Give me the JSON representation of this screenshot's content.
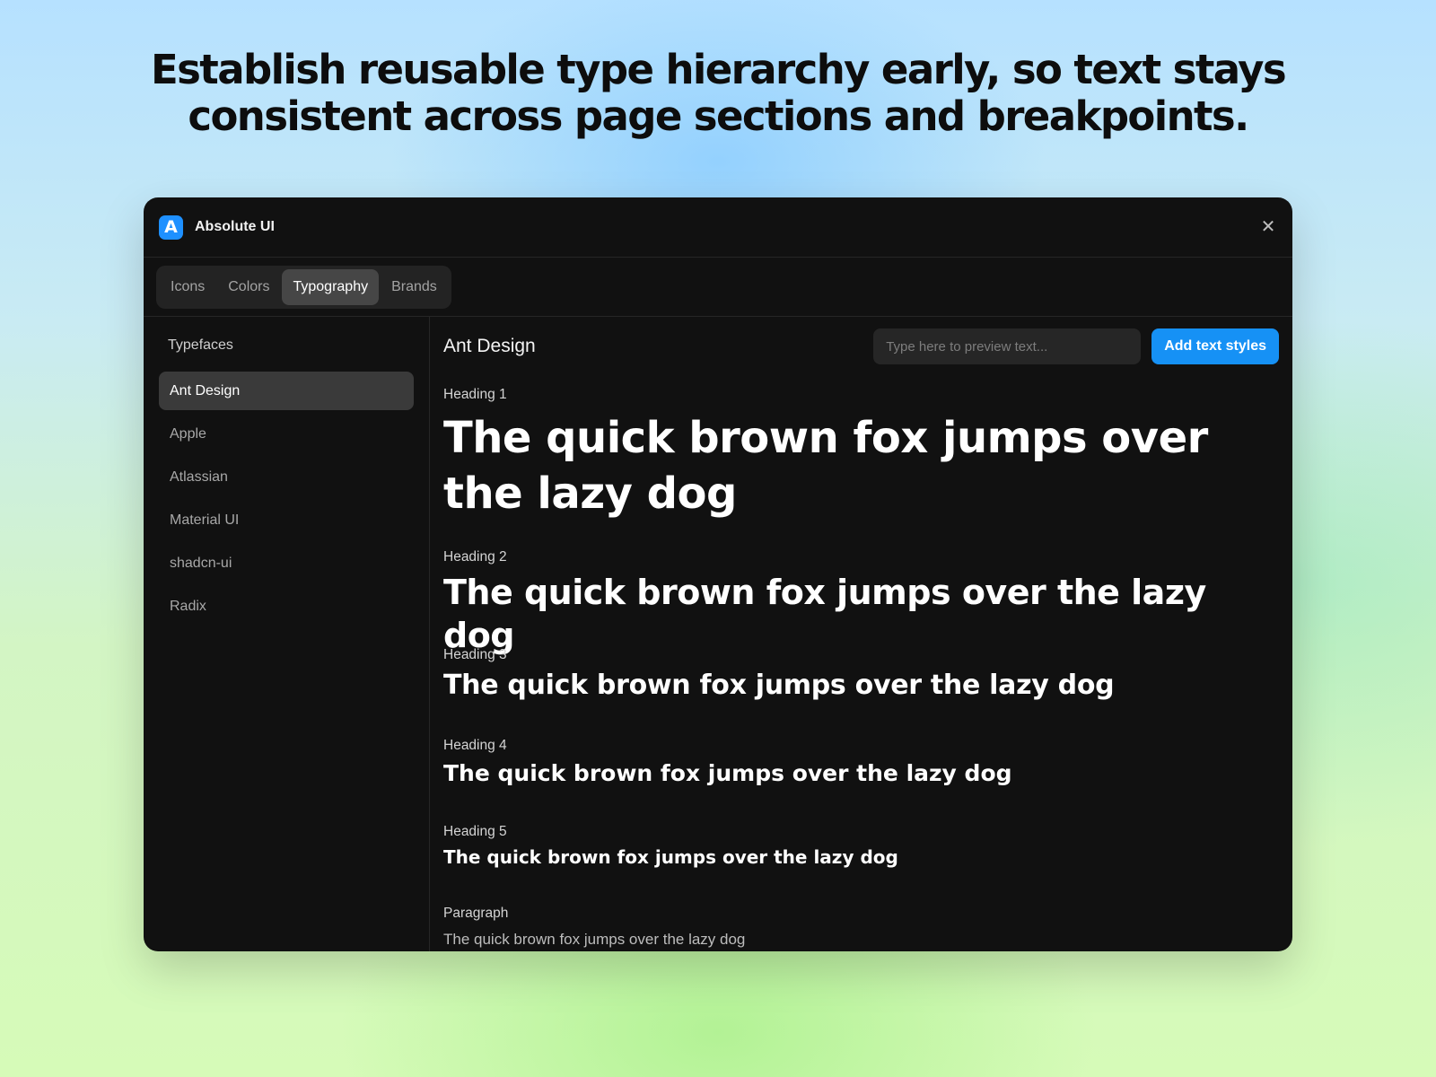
{
  "headline": {
    "line1": "Establish reusable type hierarchy early, so text stays",
    "line2": "consistent across page sections and breakpoints."
  },
  "window": {
    "app_logo_letter": "A",
    "app_title": "Absolute UI",
    "close_glyph": "✕",
    "accent_color": "#1691f5"
  },
  "tabs": [
    {
      "label": "Icons",
      "active": false
    },
    {
      "label": "Colors",
      "active": false
    },
    {
      "label": "Typography",
      "active": true
    },
    {
      "label": "Brands",
      "active": false
    }
  ],
  "sidebar": {
    "heading": "Typefaces",
    "items": [
      {
        "label": "Ant Design",
        "active": true
      },
      {
        "label": "Apple",
        "active": false
      },
      {
        "label": "Atlassian",
        "active": false
      },
      {
        "label": "Material UI",
        "active": false
      },
      {
        "label": "shadcn-ui",
        "active": false
      },
      {
        "label": "Radix",
        "active": false
      }
    ]
  },
  "main": {
    "title": "Ant Design",
    "preview_placeholder": "Type here to preview text...",
    "add_button_label": "Add text styles",
    "styles": [
      {
        "label": "Heading 1",
        "sample": "The quick brown fox jumps over the lazy dog"
      },
      {
        "label": "Heading 2",
        "sample": "The quick brown fox jumps over the lazy dog"
      },
      {
        "label": "Heading 3",
        "sample": "The quick brown fox jumps over the lazy dog"
      },
      {
        "label": "Heading 4",
        "sample": "The quick brown fox jumps over the lazy dog"
      },
      {
        "label": "Heading 5",
        "sample": "The quick brown fox jumps over the lazy dog"
      },
      {
        "label": "Paragraph",
        "sample": "The quick brown fox jumps over the lazy dog"
      }
    ]
  }
}
